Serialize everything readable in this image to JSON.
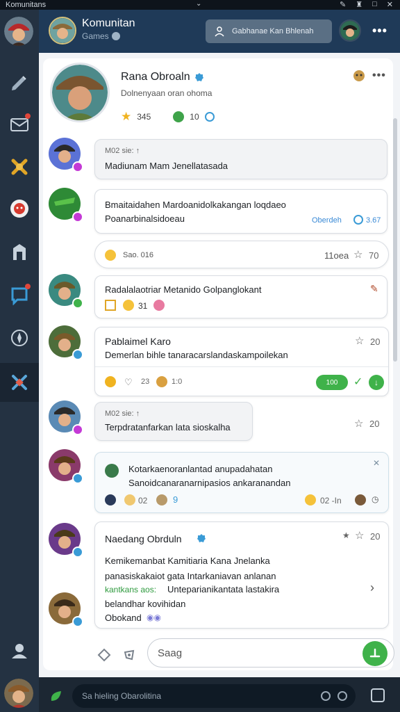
{
  "os_bar": {
    "title": "Komunitans",
    "center": "⌄",
    "controls": [
      "✎",
      "♜",
      "□",
      "✕"
    ]
  },
  "header": {
    "title": "Komunitan",
    "subtitle": "Games",
    "search_label": "Gabhanae Kan Bhlenah"
  },
  "profile": {
    "name": "Rana Obroaln",
    "subtitle": "Dolnenyaan oran ohoma",
    "stat1": "345",
    "stat2": "10"
  },
  "messages": [
    {
      "meta": "M02 sie: ↑",
      "text": "Madiunam Mam Jenellatasada"
    },
    {
      "text1": "Bmaitaidahen Mardoanidolkakangan loqdaeo",
      "text2": "Poanarbinalsidoeau",
      "side": "Oberdeh",
      "side_count": "3.67"
    },
    {
      "react": "Sao. 016",
      "right": "11oea",
      "stars": "70"
    },
    {
      "text": "Radalalaotriar Metanido Golpanglokant",
      "count": "31"
    },
    {
      "title": "Pablaimel Karo",
      "text": "Demerlan bihle tanaracarslandaskampoilekan",
      "stars": "20",
      "count1": "23",
      "count2": "1:0",
      "pill": "100"
    },
    {
      "meta": "M02 sie: ↑",
      "text": "Terpdratanfarkan lata sioskalha",
      "stars": "20"
    },
    {
      "text1": "Kotarkaenoranlantad anupadahatan",
      "text2": "Sanoidcanaranarnipasios ankaranandan",
      "count1": "02",
      "count2": "02 -In"
    },
    {
      "title": "Naedang Obrduln",
      "stars": "20",
      "line1": "Kemikemanbat Kamitiaria Kana Jnelanka",
      "line2": "panasiskakaiot gata Intarkaniavan anlanan",
      "line3a": "kantkans aos:",
      "line3b": "Unteparianikantata lastakira",
      "line4": "belandhar kovihidan",
      "line5": "Obokand"
    }
  ],
  "composer": {
    "placeholder": "Saag"
  },
  "bottom": {
    "placeholder": "Sa hieling Obarolitina"
  },
  "colors": {
    "accent": "#3fb24a",
    "header": "#1f3a58",
    "rail": "#243242"
  }
}
